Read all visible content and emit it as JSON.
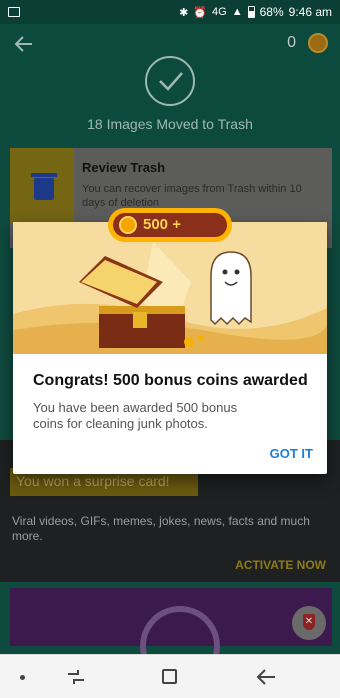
{
  "status_bar": {
    "battery": "68%",
    "time": "9:46 am",
    "signal": "4G"
  },
  "header": {
    "coin_count": "0",
    "title": "18 Images Moved to Trash"
  },
  "review_card": {
    "title": "Review Trash",
    "description": "You can recover images from Trash within 10 days of deletion"
  },
  "surprise_card": {
    "banner": "You won a surprise card!",
    "description": "Viral videos, GIFs, memes, jokes, news, facts and much more.",
    "action": "ACTIVATE NOW"
  },
  "dialog": {
    "bonus_label": "500 +",
    "title": "Congrats! 500 bonus coins awarded",
    "message": "You have been awarded 500 bonus coins for cleaning junk photos.",
    "button": "GOT IT"
  },
  "colors": {
    "accent": "#1c7ed6",
    "gold": "#ffb300",
    "teal": "#0d4a3e"
  }
}
